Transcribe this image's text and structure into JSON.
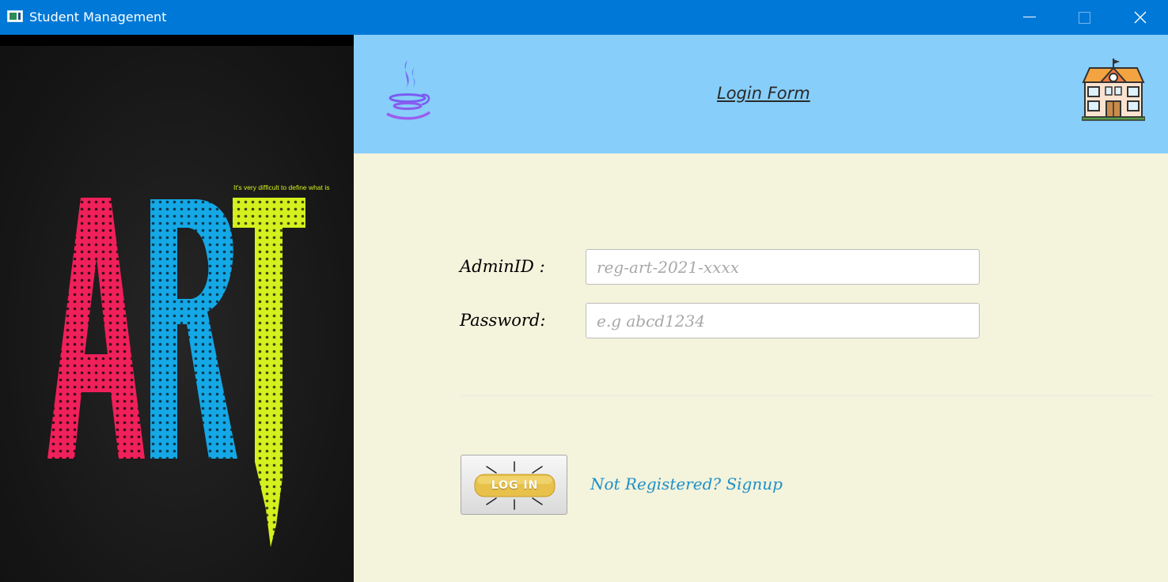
{
  "window": {
    "title": "Student Management",
    "titlebar_color": "#0078d7",
    "controls": {
      "minimize": "minimize-icon",
      "maximize": "maximize-icon",
      "close": "close-icon"
    }
  },
  "art_panel": {
    "image": "art-poster-image",
    "tagline": "It's very difficult to define what is",
    "letters": [
      "A",
      "R",
      "T"
    ],
    "colors": {
      "A": "#f0205a",
      "R": "#14a8e6",
      "T": "#d4f01e",
      "background": "#161616"
    }
  },
  "header": {
    "title": "Login Form",
    "background": "#87cefa",
    "left_icon": "java-logo-icon",
    "right_icon": "school-building-icon"
  },
  "form": {
    "admin_label": "AdminID :",
    "admin_placeholder": "reg-art-2021-xxxx",
    "admin_value": "",
    "password_label": "Password:",
    "password_placeholder": "e.g abcd1234",
    "password_value": "",
    "login_button": "LOG IN",
    "signup_link": "Not Registered? Signup",
    "background": "#f4f3dc",
    "link_color": "#1e90c8"
  }
}
